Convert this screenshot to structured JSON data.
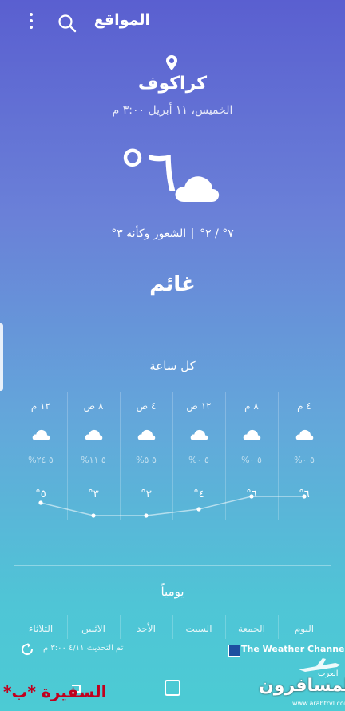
{
  "header": {
    "title": "المواقع",
    "icons": [
      "more-vert-icon",
      "search-icon"
    ]
  },
  "location": {
    "pin_icon": "location-pin-icon",
    "city": "كراكوف",
    "datetime": "الخميس، ١١ أبريل ٣:٠٠ م"
  },
  "current": {
    "temperature": "٦°",
    "icon": "cloud-icon",
    "high_low": "٧° / ٢°",
    "feels_like": "الشعور وكأنه ٣°",
    "condition": "غائم"
  },
  "hourly": {
    "title": "كل ساعة",
    "items": [
      {
        "time": "٤ م",
        "precip": "٥ ٠%",
        "temp": "٦°"
      },
      {
        "time": "٨ م",
        "precip": "٥ ٠%",
        "temp": "٦°"
      },
      {
        "time": "١٢ ص",
        "precip": "٥ ٠%",
        "temp": "٤°"
      },
      {
        "time": "٤ ص",
        "precip": "٥ ٥%",
        "temp": "٣°"
      },
      {
        "time": "٨ ص",
        "precip": "٥ ١١%",
        "temp": "٣°"
      },
      {
        "time": "١٢ م",
        "precip": "٥ ٢٤%",
        "temp": "٥°"
      }
    ]
  },
  "daily": {
    "title": "يومياً",
    "days": [
      "اليوم",
      "الجمعة",
      "السبت",
      "الأحد",
      "الاثنين",
      "الثلاثاء"
    ]
  },
  "footer": {
    "updated": "تم التحديث ٤/١١ ٣:٠٠ م",
    "provider": "The Weather Channel",
    "refresh_icon": "refresh-icon"
  },
  "watermarks": {
    "left": "السفيرة *ب*",
    "brand": "المسافرون",
    "brand_sub": "العرب",
    "site": "www.arabtrvl.com"
  },
  "colors": {
    "bg_top": "#5a5fd0",
    "bg_bottom": "#4ccbd4",
    "watermark_red": "#c1001e"
  }
}
